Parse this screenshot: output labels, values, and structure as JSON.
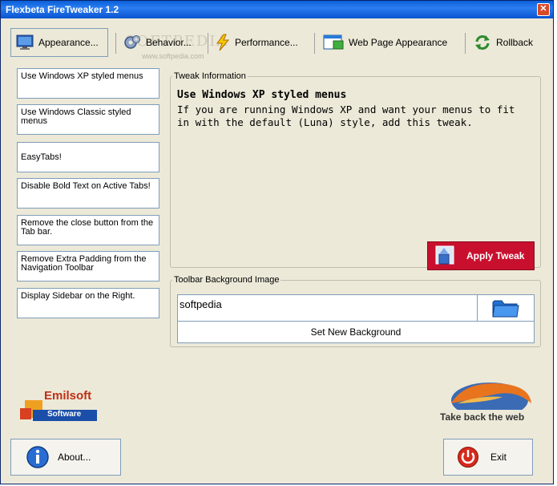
{
  "window": {
    "title": "Flexbeta FireTweaker 1.2",
    "close_glyph": "✕"
  },
  "watermark": {
    "main": "SOFTPEDIA",
    "sub": "www.softpedia.com"
  },
  "toolbar": {
    "appearance_label": "Appearance...",
    "behavior_label": "Behavior...",
    "performance_label": "Performance...",
    "webpage_label": "Web Page Appearance",
    "rollback_label": "Rollback"
  },
  "tweaks": [
    {
      "label": "Use Windows XP styled menus"
    },
    {
      "label": "Use Windows Classic styled menus"
    },
    {
      "label": "EasyTabs!"
    },
    {
      "label": "Disable Bold Text on Active Tabs!"
    },
    {
      "label": "Remove the close button from the Tab bar."
    },
    {
      "label": "Remove Extra Padding from  the  Navigation Toolbar"
    },
    {
      "label": "Display Sidebar on the Right."
    }
  ],
  "tweak_info": {
    "legend": "Tweak Information",
    "title": "Use Windows XP styled menus",
    "description": "If you are running Windows XP and want your menus to fit in with the default (Luna) style, add this tweak.",
    "apply_label": "Apply Tweak"
  },
  "toolbar_bg": {
    "legend": "Toolbar Background Image",
    "value": "softpedia",
    "set_label": "Set New Background"
  },
  "branding": {
    "emilsoft_top": "Emilsoft",
    "emilsoft_bottom": "Software",
    "firefox_tagline": "Take back the web"
  },
  "footer": {
    "about_label": "About...",
    "exit_label": "Exit"
  },
  "colors": {
    "title_bar": "#0a5fd8",
    "apply_red": "#c8102e",
    "window_bg": "#ece9d8"
  }
}
